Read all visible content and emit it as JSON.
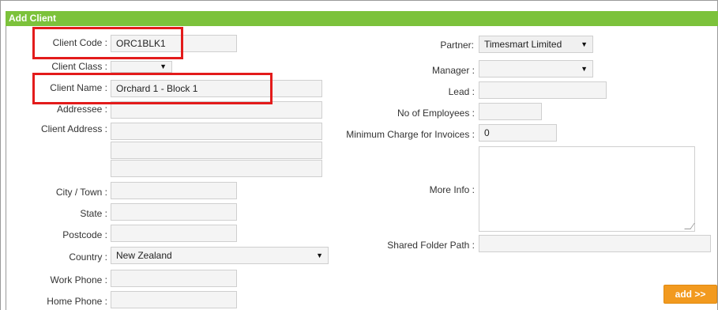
{
  "header": {
    "title": "Add Client"
  },
  "left": {
    "client_code": {
      "label": "Client Code :",
      "value": "ORC1BLK1"
    },
    "client_class": {
      "label": "Client Class :",
      "value": ""
    },
    "client_name": {
      "label": "Client Name :",
      "value": "Orchard 1 - Block 1"
    },
    "addressee": {
      "label": "Addressee :",
      "value": ""
    },
    "client_address": {
      "label": "Client Address :",
      "line1": "",
      "line2": "",
      "line3": ""
    },
    "city": {
      "label": "City / Town :",
      "value": ""
    },
    "state": {
      "label": "State :",
      "value": ""
    },
    "postcode": {
      "label": "Postcode :",
      "value": ""
    },
    "country": {
      "label": "Country :",
      "value": "New Zealand"
    },
    "work_phone": {
      "label": "Work Phone :",
      "value": ""
    },
    "home_phone": {
      "label": "Home Phone :",
      "value": ""
    }
  },
  "right": {
    "partner": {
      "label": "Partner:",
      "value": "Timesmart Limited"
    },
    "manager": {
      "label": "Manager :",
      "value": ""
    },
    "lead": {
      "label": "Lead :",
      "value": ""
    },
    "employees": {
      "label": "No of Employees :",
      "value": ""
    },
    "min_charge": {
      "label": "Minimum Charge for Invoices :",
      "value": "0"
    },
    "more_info": {
      "label": "More Info :",
      "value": ""
    },
    "shared_folder": {
      "label": "Shared Folder Path :",
      "value": ""
    }
  },
  "actions": {
    "add_label": "add >>"
  },
  "colors": {
    "header": "#7cc23b",
    "highlight": "#e31b1b",
    "add_button": "#f29a1f"
  },
  "icons": {
    "dropdown": "caret-down-icon",
    "resize": "resize-grip-icon"
  }
}
